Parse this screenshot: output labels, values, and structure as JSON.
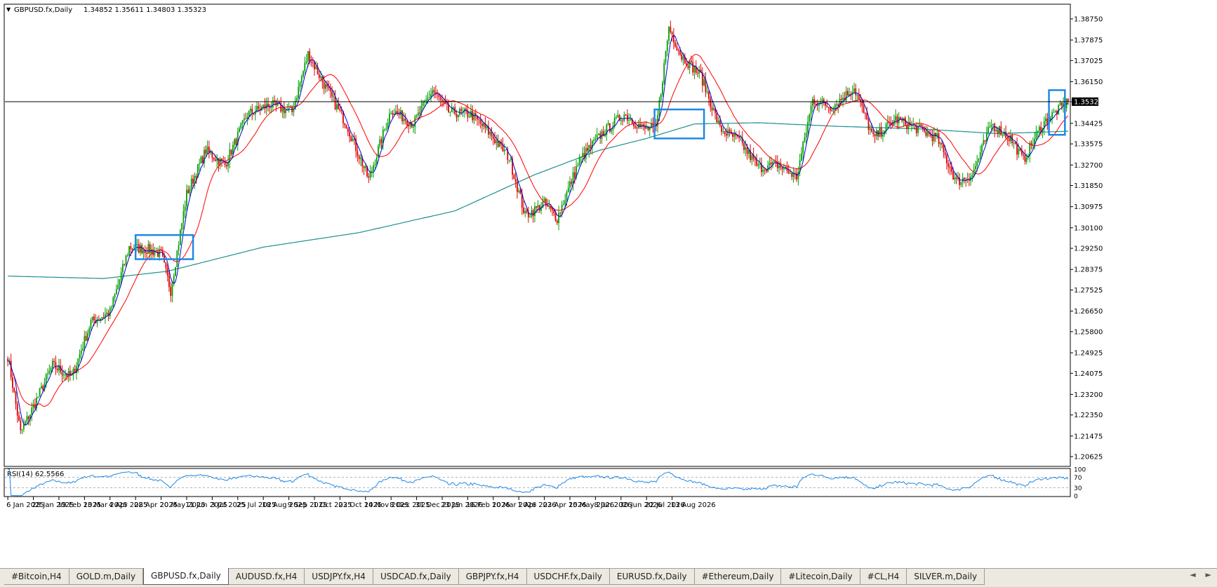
{
  "chart_header": {
    "symbol_label": "GBPUSD.fx,Daily",
    "ohlc": "1.34852 1.35611 1.34803 1.35323",
    "menu_icon": "triangle-down-icon"
  },
  "chart_data": [
    {
      "type": "candlestick",
      "title": "GBPUSD.fx,Daily",
      "ylim": [
        1.2025,
        1.393
      ],
      "y_ticks": [
        "1.38750",
        "1.37875",
        "1.37025",
        "1.36150",
        "1.35323",
        "1.34425",
        "1.33575",
        "1.32700",
        "1.31850",
        "1.30975",
        "1.30100",
        "1.29250",
        "1.28375",
        "1.27525",
        "1.26650",
        "1.25800",
        "1.24925",
        "1.24075",
        "1.23200",
        "1.22350",
        "1.21475",
        "1.20625"
      ],
      "current_price": "1.35323",
      "x_ticks": [
        "6 Jan 2025",
        "28 Jan 2025",
        "19 Feb 2025",
        "13 Mar 2025",
        "4 Apr 2025",
        "28 Apr 2025",
        "20 May 2025",
        "11 Jun 2025",
        "3 Jul 2025",
        "25 Jul 2025",
        "18 Aug 2025",
        "9 Sep 2025",
        "1 Oct 2025",
        "23 Oct 2025",
        "14 Nov 2025",
        "8 Dec 2025",
        "31 Dec 2025",
        "23 Jan 2026",
        "16 Feb 2026",
        "10 Mar 2026",
        "1 Apr 2026",
        "23 Apr 2026",
        "15 May 2026",
        "8 Jun 2026",
        "30 Jun 2026",
        "22 Jul 2026",
        "13 Aug 2026"
      ],
      "bars_per_tick": 16,
      "price_path": [
        [
          0,
          1.248
        ],
        [
          8,
          1.216
        ],
        [
          16,
          1.227
        ],
        [
          28,
          1.244
        ],
        [
          40,
          1.239
        ],
        [
          52,
          1.262
        ],
        [
          64,
          1.266
        ],
        [
          76,
          1.293
        ],
        [
          88,
          1.292
        ],
        [
          96,
          1.29
        ],
        [
          102,
          1.275
        ],
        [
          112,
          1.315
        ],
        [
          124,
          1.333
        ],
        [
          136,
          1.327
        ],
        [
          150,
          1.348
        ],
        [
          164,
          1.352
        ],
        [
          178,
          1.349
        ],
        [
          188,
          1.373
        ],
        [
          200,
          1.358
        ],
        [
          212,
          1.344
        ],
        [
          226,
          1.321
        ],
        [
          240,
          1.35
        ],
        [
          254,
          1.344
        ],
        [
          266,
          1.358
        ],
        [
          276,
          1.349
        ],
        [
          290,
          1.348
        ],
        [
          302,
          1.34
        ],
        [
          314,
          1.33
        ],
        [
          324,
          1.306
        ],
        [
          336,
          1.311
        ],
        [
          344,
          1.305
        ],
        [
          358,
          1.329
        ],
        [
          372,
          1.34
        ],
        [
          386,
          1.348
        ],
        [
          398,
          1.342
        ],
        [
          406,
          1.342
        ],
        [
          414,
          1.384
        ],
        [
          422,
          1.372
        ],
        [
          434,
          1.364
        ],
        [
          446,
          1.342
        ],
        [
          458,
          1.337
        ],
        [
          470,
          1.326
        ],
        [
          482,
          1.327
        ],
        [
          494,
          1.322
        ],
        [
          504,
          1.354
        ],
        [
          516,
          1.351
        ],
        [
          530,
          1.359
        ],
        [
          542,
          1.338
        ],
        [
          556,
          1.346
        ],
        [
          570,
          1.342
        ],
        [
          582,
          1.338
        ],
        [
          594,
          1.32
        ],
        [
          604,
          1.323
        ],
        [
          616,
          1.344
        ],
        [
          628,
          1.338
        ],
        [
          636,
          1.329
        ],
        [
          648,
          1.344
        ],
        [
          658,
          1.35
        ],
        [
          664,
          1.3532
        ]
      ],
      "ma_fast": {
        "color": "#0000cc",
        "period": 5
      },
      "ma_mid": {
        "color": "#ff0000",
        "period": 21
      },
      "ma_slow": {
        "color": "#1b8f8f",
        "path": [
          [
            0,
            1.281
          ],
          [
            60,
            1.28
          ],
          [
            100,
            1.283
          ],
          [
            160,
            1.293
          ],
          [
            220,
            1.299
          ],
          [
            280,
            1.308
          ],
          [
            330,
            1.323
          ],
          [
            370,
            1.333
          ],
          [
            400,
            1.338
          ],
          [
            430,
            1.344
          ],
          [
            470,
            1.3445
          ],
          [
            520,
            1.343
          ],
          [
            570,
            1.342
          ],
          [
            620,
            1.34
          ],
          [
            664,
            1.341
          ]
        ]
      },
      "bull_color": "#00a000",
      "bear_color": "#e00000",
      "highlight_color": "#1e88e5",
      "highlight_boxes": [
        {
          "bar_from": 80,
          "bar_to": 116,
          "y_top": 1.298,
          "y_bottom": 1.288
        },
        {
          "bar_from": 405,
          "bar_to": 436,
          "y_top": 1.35,
          "y_bottom": 1.338
        },
        {
          "bar_from": 652,
          "bar_to": 662,
          "y_top": 1.358,
          "y_bottom": 1.3395
        }
      ]
    },
    {
      "type": "line",
      "title": "RSI(14) 62.5566",
      "ylim": [
        0,
        100
      ],
      "y_ticks": [
        "100",
        "70",
        "30",
        "0"
      ],
      "levels": [
        70,
        30
      ],
      "line_color": "#1e88e5",
      "last_value": 62.5566
    }
  ],
  "tabs": [
    {
      "label": "#Bitcoin,H4",
      "active": false
    },
    {
      "label": "GOLD.m,Daily",
      "active": false
    },
    {
      "label": "GBPUSD.fx,Daily",
      "active": true
    },
    {
      "label": "AUDUSD.fx,H4",
      "active": false
    },
    {
      "label": "USDJPY.fx,H4",
      "active": false
    },
    {
      "label": "USDCAD.fx,Daily",
      "active": false
    },
    {
      "label": "GBPJPY.fx,H4",
      "active": false
    },
    {
      "label": "USDCHF.fx,Daily",
      "active": false
    },
    {
      "label": "EURUSD.fx,Daily",
      "active": false
    },
    {
      "label": "#Ethereum,Daily",
      "active": false
    },
    {
      "label": "#Litecoin,Daily",
      "active": false
    },
    {
      "label": "#CL,H4",
      "active": false
    },
    {
      "label": "SILVER.m,Daily",
      "active": false
    }
  ],
  "tab_scroll": {
    "left_icon": "arrow-left-icon",
    "right_icon": "arrow-right-icon",
    "left": "◄",
    "right": "►"
  },
  "rsi_header": {
    "label": "RSI(14) 62.5566"
  }
}
